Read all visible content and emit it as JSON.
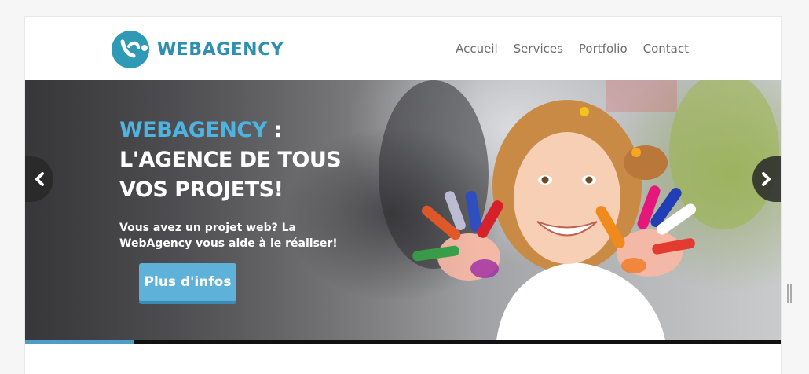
{
  "brand": {
    "name": "WEBAGENCY",
    "logo_icon": "webagency-logo-icon",
    "color": "#2f8fb0"
  },
  "nav": {
    "items": [
      {
        "label": "Accueil"
      },
      {
        "label": "Services"
      },
      {
        "label": "Portfolio"
      },
      {
        "label": "Contact"
      }
    ]
  },
  "hero": {
    "title_brand": "WEBAGENCY",
    "title_colon": " :",
    "title_line2": "L'AGENCE DE TOUS",
    "title_line3": "VOS PROJETS!",
    "subtitle": "Vous avez un projet web? La WebAgency vous aide à le réaliser!",
    "button_label": "Plus d'infos",
    "image": "smiling-girl-painted-hands-photo",
    "prev_icon": "chevron-left-icon",
    "next_icon": "chevron-right-icon",
    "accent_color": "#4fb3e0",
    "progress_fraction": 0.145
  }
}
